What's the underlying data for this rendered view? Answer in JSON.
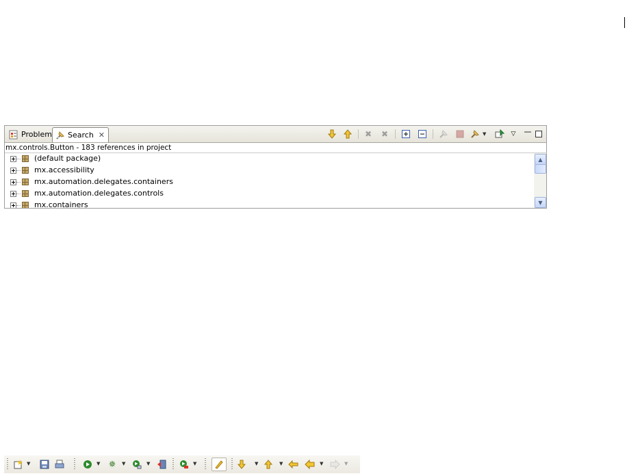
{
  "tabs": {
    "problems": "Problems",
    "search": "Search"
  },
  "summary": "mx.controls.Button - 183 references in project",
  "results": [
    "(default package)",
    "mx.accessibility",
    "mx.automation.delegates.containers",
    "mx.automation.delegates.controls",
    "mx.containers"
  ],
  "icons": {
    "view_toolbar": [
      "next-match-icon",
      "previous-match-icon",
      "remove-selected-icon",
      "remove-all-icon",
      "expand-all-icon",
      "collapse-all-icon",
      "run-search-icon",
      "cancel-search-icon",
      "search-history-icon",
      "pin-view-icon",
      "view-menu-icon",
      "minimize-icon",
      "maximize-icon"
    ],
    "main_toolbar": [
      "new-icon",
      "save-icon",
      "print-icon",
      "run-icon",
      "debug-icon",
      "profile-icon",
      "export-release-icon",
      "external-tools-icon",
      "mark-occurrences-icon",
      "next-annotation-icon",
      "previous-annotation-icon",
      "last-edit-location-icon",
      "back-icon",
      "forward-icon"
    ]
  },
  "colors": {
    "tab_bar": "#e6e4da",
    "scrollbar_accent": "#c6d6f7",
    "run_green": "#2e8b2e",
    "arrow_yellow": "#e0b000"
  }
}
